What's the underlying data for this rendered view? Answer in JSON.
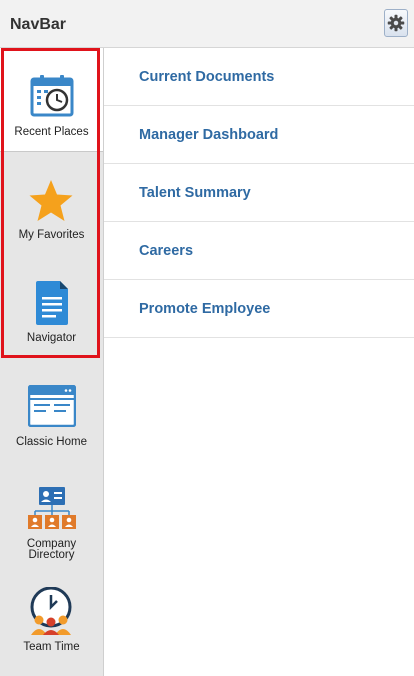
{
  "header": {
    "title": "NavBar",
    "settings_icon": "gear-icon"
  },
  "sidebar": {
    "items": [
      {
        "label": "Recent Places",
        "icon": "calendar-clock-icon",
        "active": true
      },
      {
        "label": "My Favorites",
        "icon": "star-icon",
        "active": false
      },
      {
        "label": "Navigator",
        "icon": "document-icon",
        "active": false
      },
      {
        "label": "Classic Home",
        "icon": "browser-window-icon",
        "active": false
      },
      {
        "label": "Company\nDirectory",
        "icon": "org-chart-icon",
        "active": false
      },
      {
        "label": "Team Time",
        "icon": "team-clock-icon",
        "active": false
      }
    ]
  },
  "recent_places": {
    "items": [
      "Current Documents",
      "Manager Dashboard",
      "Talent Summary",
      "Careers",
      "Promote Employee"
    ]
  },
  "colors": {
    "accent_blue": "#2f6aa3",
    "highlight_red": "#e0131b",
    "star_orange": "#f5a11c"
  }
}
